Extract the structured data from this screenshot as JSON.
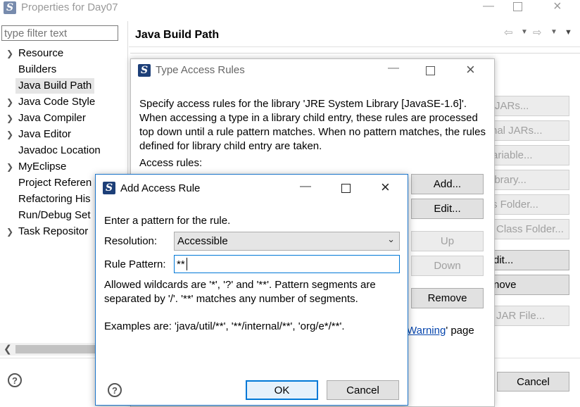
{
  "properties": {
    "title": "Properties for Day07",
    "filter_placeholder": "type filter text",
    "page_title": "Java Build Path",
    "tree": [
      {
        "label": "Resource",
        "expandable": true
      },
      {
        "label": "Builders",
        "expandable": false
      },
      {
        "label": "Java Build Path",
        "expandable": false,
        "selected": true
      },
      {
        "label": "Java Code Style",
        "expandable": true
      },
      {
        "label": "Java Compiler",
        "expandable": true
      },
      {
        "label": "Java Editor",
        "expandable": true
      },
      {
        "label": "Javadoc Location",
        "expandable": false
      },
      {
        "label": "MyEclipse",
        "expandable": true
      },
      {
        "label": "Project Referen",
        "expandable": false
      },
      {
        "label": "Refactoring His",
        "expandable": false
      },
      {
        "label": "Run/Debug Set",
        "expandable": false
      },
      {
        "label": "Task Repositor",
        "expandable": true
      }
    ],
    "right_buttons": [
      "JARs...",
      "rnal JARs...",
      "ariable...",
      "ibrary...",
      "s Folder...",
      "Class Folder...",
      "dit...",
      "nove",
      "JAR File..."
    ],
    "page_text": "' page",
    "cancel": "Cancel"
  },
  "type_access": {
    "title": "Type Access Rules",
    "description": "Specify access rules for the library 'JRE System Library [JavaSE-1.6]'. When accessing a type in a library child entry, these rules are processed top down until a rule pattern matches. When no pattern matches, the rules defined for library child entry are taken.",
    "rules_label": "Access rules:",
    "buttons": {
      "add": "Add...",
      "edit": "Edit...",
      "up": "Up",
      "down": "Down",
      "remove": "Remove"
    },
    "warning_link": "Warning"
  },
  "add_rule": {
    "title": "Add Access Rule",
    "prompt": "Enter a pattern for the rule.",
    "resolution_label": "Resolution:",
    "resolution_value": "Accessible",
    "pattern_label": "Rule Pattern:",
    "pattern_value": "**",
    "help_text": "Allowed wildcards are '*', '?' and '**'. Pattern segments are separated by '/'. '**' matches any number of segments.",
    "examples": "Examples are: 'java/util/**', '**/internal/**', 'org/e*/**'.",
    "ok": "OK",
    "cancel": "Cancel"
  }
}
